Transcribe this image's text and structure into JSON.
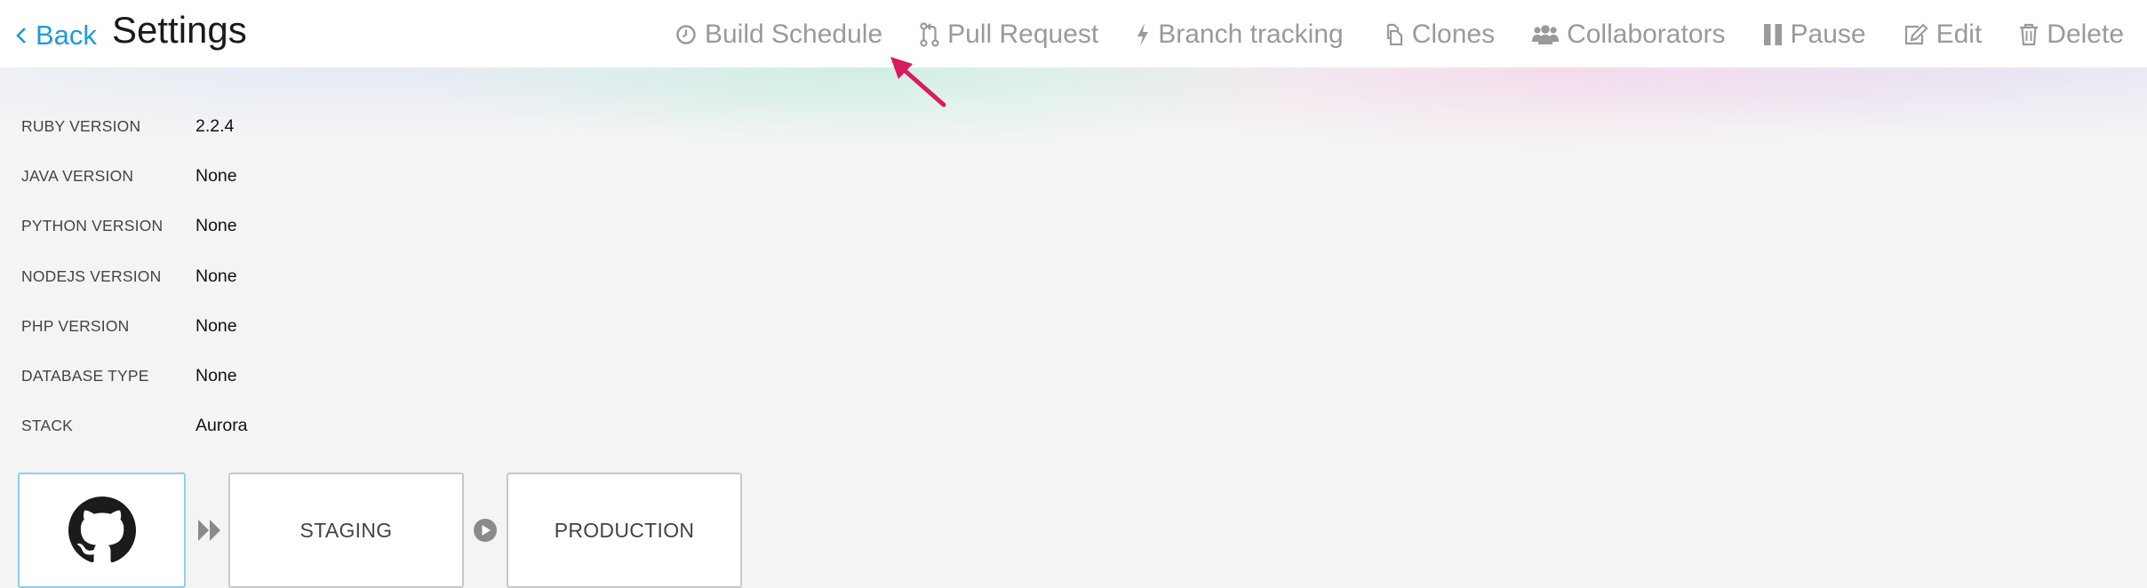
{
  "header": {
    "back_label": "Back",
    "title": "Settings",
    "toolbar": [
      {
        "label": "Build Schedule",
        "icon": "clock-icon"
      },
      {
        "label": "Pull Request",
        "icon": "pull-request-icon"
      },
      {
        "label": "Branch tracking",
        "icon": "bolt-icon"
      },
      {
        "label": "Clones",
        "icon": "clone-icon"
      },
      {
        "label": "Collaborators",
        "icon": "users-icon"
      },
      {
        "label": "Pause",
        "icon": "pause-icon"
      },
      {
        "label": "Edit",
        "icon": "edit-icon"
      },
      {
        "label": "Delete",
        "icon": "trash-icon"
      }
    ]
  },
  "settings": [
    {
      "label": "RUBY VERSION",
      "value": "2.2.4"
    },
    {
      "label": "JAVA VERSION",
      "value": "None"
    },
    {
      "label": "PYTHON VERSION",
      "value": "None"
    },
    {
      "label": "NODEJS VERSION",
      "value": "None"
    },
    {
      "label": "PHP VERSION",
      "value": "None"
    },
    {
      "label": "DATABASE TYPE",
      "value": "None"
    },
    {
      "label": "STACK",
      "value": "Aurora"
    }
  ],
  "pipeline": {
    "source_icon": "github-icon",
    "stages": [
      {
        "label": "STAGING"
      },
      {
        "label": "PRODUCTION"
      }
    ]
  },
  "colors": {
    "accent": "#1f9bd7",
    "annotation_arrow": "#d81b60",
    "toolbar_text": "#9a9a9a",
    "source_border": "#8dd0ef"
  }
}
